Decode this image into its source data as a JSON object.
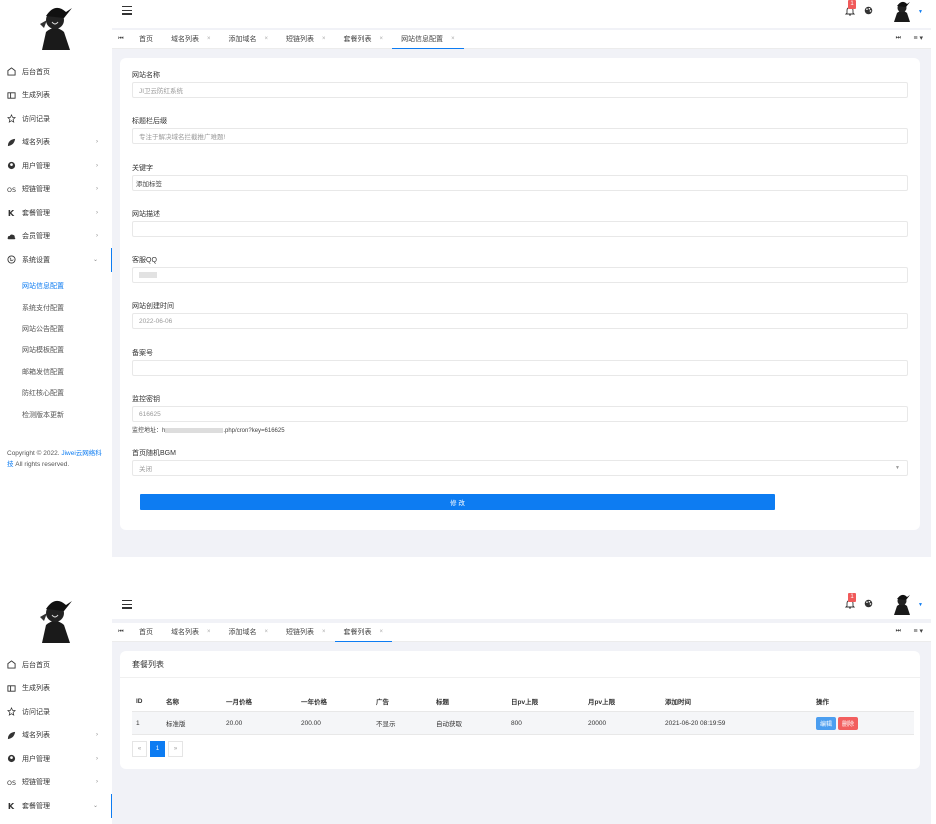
{
  "colors": {
    "accent": "#0d7cf2",
    "badge": "#f05a5a",
    "edit": "#4b9ef0",
    "delete": "#f25e5e"
  },
  "sidebar": {
    "items": [
      {
        "label": "后台首页",
        "icon": "dashboard-icon"
      },
      {
        "label": "生成列表",
        "icon": "list-icon"
      },
      {
        "label": "访问记录",
        "icon": "record-icon"
      },
      {
        "label": "域名列表",
        "icon": "leaf-icon",
        "arrow": "›"
      },
      {
        "label": "用户管理",
        "icon": "user-icon",
        "arrow": "›"
      },
      {
        "label": "短链管理",
        "icon": "link-icon",
        "arrow": "›"
      },
      {
        "label": "套餐管理",
        "icon": "k-icon",
        "arrow": "›"
      },
      {
        "label": "会员管理",
        "icon": "cloud-icon",
        "arrow": "›"
      },
      {
        "label": "系统设置",
        "icon": "globe-icon",
        "arrow": "⌄"
      }
    ],
    "sub_items": [
      "网站信息配置",
      "系统支付配置",
      "网站公告配置",
      "网站模板配置",
      "邮箱发信配置",
      "防红核心配置",
      "检测版本更新"
    ],
    "copyright_prefix": "Copyright © 2022.",
    "copyright_link": "Jiwei云网络科技",
    "copyright_suffix": " All rights reserved."
  },
  "sidebar2": {
    "items": [
      {
        "label": "后台首页",
        "icon": "dashboard-icon"
      },
      {
        "label": "生成列表",
        "icon": "list-icon"
      },
      {
        "label": "访问记录",
        "icon": "record-icon"
      },
      {
        "label": "域名列表",
        "icon": "leaf-icon",
        "arrow": "›"
      },
      {
        "label": "用户管理",
        "icon": "user-icon",
        "arrow": "›"
      },
      {
        "label": "短链管理",
        "icon": "link-icon",
        "arrow": "›"
      },
      {
        "label": "套餐管理",
        "icon": "k-icon",
        "arrow": "⌄"
      }
    ]
  },
  "topbar": {
    "badge_count": "1"
  },
  "tabs1": [
    {
      "label": "首页",
      "close": ""
    },
    {
      "label": "域名列表",
      "close": "×"
    },
    {
      "label": "添加域名",
      "close": "×"
    },
    {
      "label": "短链列表",
      "close": "×"
    },
    {
      "label": "套餐列表",
      "close": "×"
    },
    {
      "label": "网站信息配置",
      "close": "×"
    }
  ],
  "tabs2": [
    {
      "label": "首页",
      "close": ""
    },
    {
      "label": "域名列表",
      "close": "×"
    },
    {
      "label": "添加域名",
      "close": "×"
    },
    {
      "label": "短链列表",
      "close": "×"
    },
    {
      "label": "套餐列表",
      "close": "×"
    }
  ],
  "tab_nav": {
    "left": "⏮",
    "right": "⏭",
    "menu": "≡ ▾"
  },
  "form": {
    "site_name": {
      "label": "网站名称",
      "placeholder": "JI卫云防红系统"
    },
    "subtitle": {
      "label": "标题栏后缀",
      "placeholder": "专注于解决域名拦截推广难题!"
    },
    "keywords": {
      "label": "关键字",
      "value": "添加标签"
    },
    "description": {
      "label": "网站描述",
      "value": ""
    },
    "qq": {
      "label": "客服QQ"
    },
    "created": {
      "label": "网站创建时间",
      "value": "2022-06-06"
    },
    "icp": {
      "label": "备案号",
      "value": ""
    },
    "monitor": {
      "label": "监控密钥",
      "value": "616625"
    },
    "monitor_note_prefix": "监控地址：h",
    "monitor_note_suffix": ".php/cron?key=616625",
    "bgm": {
      "label": "首页随机BGM",
      "value": "关闭"
    },
    "submit_label": "修 改"
  },
  "package_list": {
    "title": "套餐列表",
    "columns": [
      "ID",
      "名称",
      "一月价格",
      "一年价格",
      "广告",
      "标题",
      "日pv上限",
      "月pv上限",
      "添加时间",
      "操作"
    ],
    "rows": [
      [
        "1",
        "标准版",
        "20.00",
        "200.00",
        "不显示",
        "自动获取",
        "800",
        "20000",
        "2021-06-20 08:19:59"
      ]
    ],
    "edit_label": "编辑",
    "delete_label": "删除",
    "pager": {
      "prev": "«",
      "current": "1",
      "next": "»"
    }
  }
}
